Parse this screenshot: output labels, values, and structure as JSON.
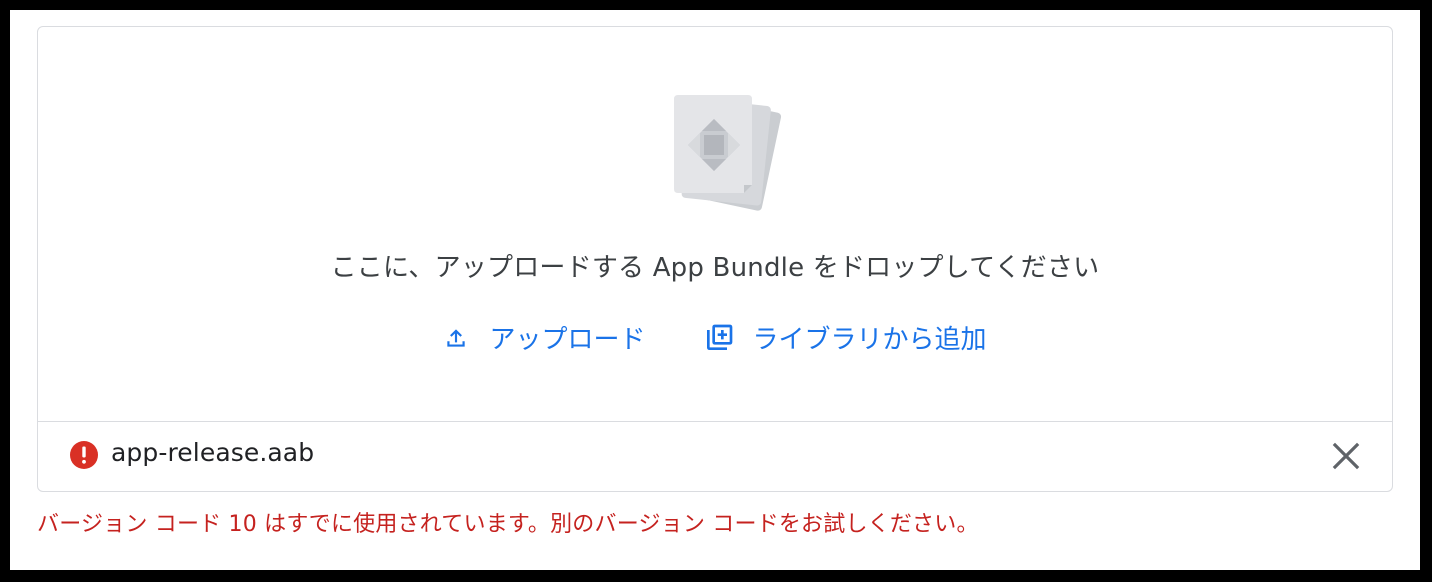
{
  "upload_card": {
    "drop_text": "ここに、アップロードする App Bundle をドロップしてください",
    "upload_label": "アップロード",
    "add_from_library_label": "ライブラリから追加",
    "illustration_icon": "app-bundle-files-icon",
    "upload_icon": "upload-icon",
    "library_icon": "add-to-library-icon"
  },
  "file": {
    "name": "app-release.aab",
    "status_icon": "error-icon",
    "status": "error",
    "remove_icon": "close-icon"
  },
  "error_message": "バージョン コード 10 はすでに使用されています。別のバージョン コードをお試しください。",
  "colors": {
    "accent": "#1a73e8",
    "error": "#c5221f",
    "border": "#dadce0",
    "text": "#3c4043"
  }
}
